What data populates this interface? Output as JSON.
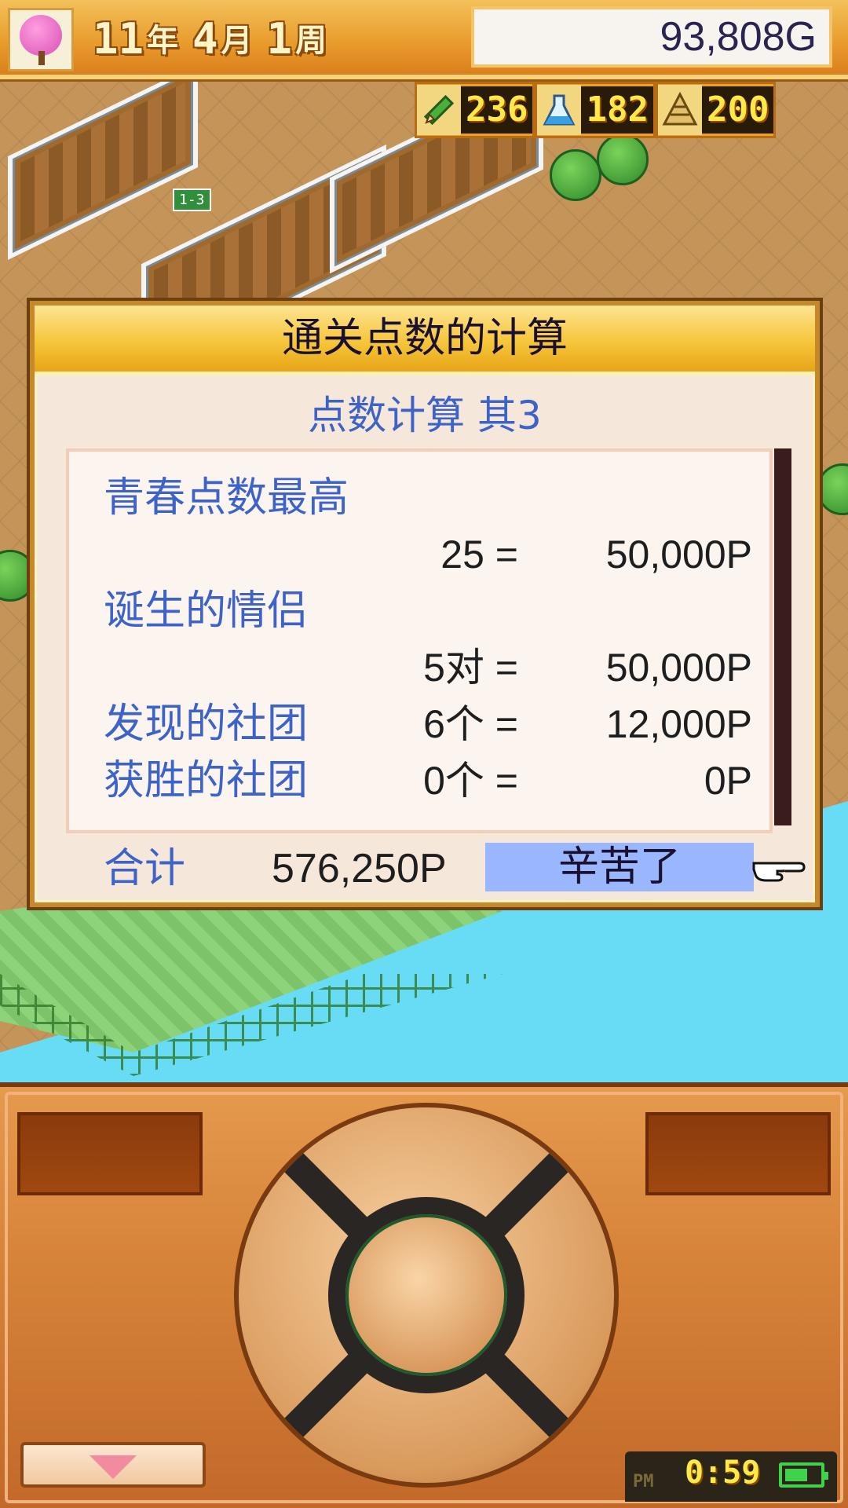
{
  "status_bar": {
    "year": "11",
    "year_unit": "年",
    "month": "4",
    "month_unit": "月",
    "week": "1",
    "week_unit": "周",
    "money": "93,808G"
  },
  "resources": [
    {
      "icon": "pencil-icon",
      "value": "236"
    },
    {
      "icon": "flask-icon",
      "value": "182"
    },
    {
      "icon": "pyramid-icon",
      "value": "200"
    }
  ],
  "dialog": {
    "title": "通关点数的计算",
    "subtitle": "点数计算 其3",
    "rows": [
      {
        "label": "青春点数最高",
        "count": "",
        "points": ""
      },
      {
        "label": "",
        "count": "25 =",
        "points": "50,000P"
      },
      {
        "label": "诞生的情侣",
        "count": "",
        "points": ""
      },
      {
        "label": "",
        "count": "5对 =",
        "points": "50,000P"
      },
      {
        "label": "发现的社团",
        "count": "6个 =",
        "points": "12,000P"
      },
      {
        "label": "获胜的社团",
        "count": "0个 =",
        "points": "0P"
      }
    ],
    "total_label": "合计",
    "total_value": "576,250P",
    "ok_label": "辛苦了"
  },
  "clock": {
    "ampm": "PM",
    "time": "0:59"
  },
  "colors": {
    "accent_blue": "#3d62c8",
    "button_highlight": "#9ab6ff",
    "title_gold": "#f6c63b",
    "water": "#67dcf4"
  }
}
